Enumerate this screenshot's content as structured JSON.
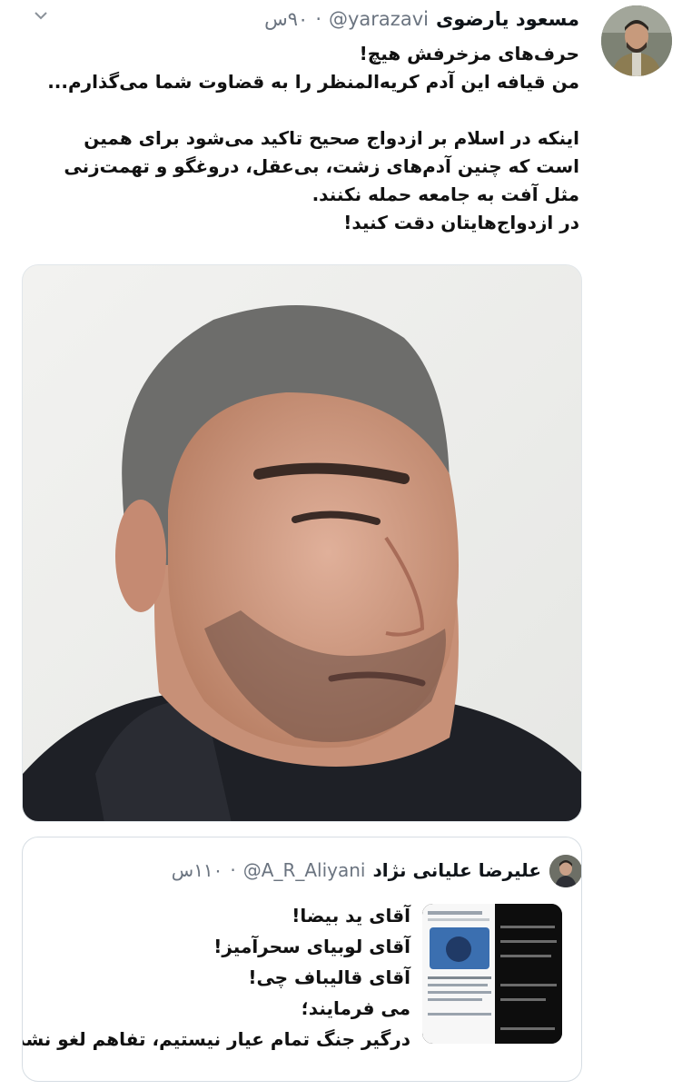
{
  "tweet": {
    "display_name": "مسعود یارضوی",
    "handle": "@yarazavi",
    "separator": "·",
    "time": "۹۰س",
    "body": {
      "line1": "حرف‌های مزخرفش هیچ!",
      "line2": "من قیافه این آدم کریه‌المنظر را به قضاوت شما می‌گذارم...",
      "line3": "اینکه در اسلام بر ازدواج صحیح تاکید می‌شود برای همین است که چنین آدم‌های زشت، بی‌عقل، دروغگو و تهمت‌زنی مثل آفت به جامعه حمله نکنند.",
      "line4": "در ازدواج‌هایتان دقت کنید!"
    }
  },
  "quoted_tweet": {
    "display_name": "علیرضا علیانی نژاد",
    "handle": "@A_R_Aliyani",
    "separator": "·",
    "time": "۱۱۰س",
    "lines": [
      "آقای ید بیضا!",
      "آقای لوبیای سحرآمیز!",
      "آقای قالیباف چی!",
      "می فرمایند؛",
      "درگیر جنگ تمام عیار نیستیم، تفاهم لغو نشده..."
    ]
  },
  "icons": {
    "overflow": "chevron-down-icon"
  },
  "colors": {
    "text": "#0f1419",
    "secondary": "#6b7480",
    "border": "#d6dde3"
  }
}
